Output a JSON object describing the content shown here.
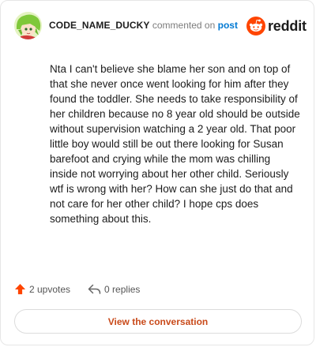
{
  "header": {
    "username": "CODE_NAME_DUCKY",
    "commented_on": "commented on",
    "post_link": "post",
    "brand": "reddit",
    "brand_color": "#ff4500"
  },
  "comment": {
    "body": "Nta I can't believe she blame her son and on top of that she never once went looking for him after they found the toddler. She needs to take responsibility of her children because no 8 year old should be outside without supervision watching a 2 year old. That poor little boy would still be out there looking for Susan barefoot and crying while the mom was chilling inside not worrying about her other child. Seriously wtf is wrong with her? How can she just do that and not care for her other child? I hope cps does something about this."
  },
  "actions": {
    "upvotes": "2 upvotes",
    "replies": "0 replies",
    "upvote_icon": "upvote-arrow-icon",
    "reply_icon": "reply-arrow-icon"
  },
  "footer": {
    "button_label": "View the conversation"
  }
}
